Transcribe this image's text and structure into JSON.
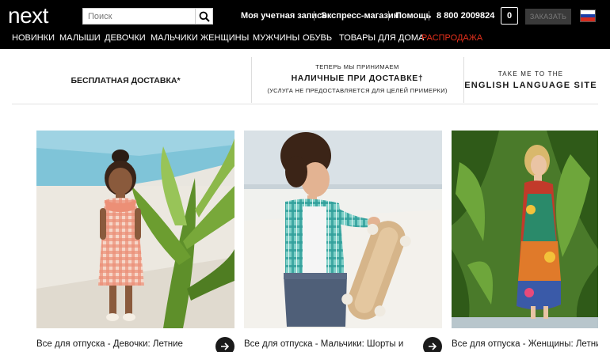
{
  "brand": {
    "logo_text": "next"
  },
  "search": {
    "placeholder": "Поиск"
  },
  "utility": {
    "account": "Моя учетная запись",
    "express": "Экспресс-магазин",
    "help": "Помощь",
    "phone": "8 800 2009824"
  },
  "bag": {
    "count": "0"
  },
  "order_button": "ЗАКАЗАТЬ",
  "nav": [
    "НОВИНКИ",
    "МАЛЫШИ",
    "ДЕВОЧКИ",
    "МАЛЬЧИКИ",
    "ЖЕНЩИНЫ",
    "МУЖЧИНЫ",
    "ОБУВЬ",
    "ТОВАРЫ ДЛЯ ДОМА",
    "РАСПРОДАЖА"
  ],
  "promo": {
    "free_delivery": "БЕСПЛАТНАЯ ДОСТАВКА*",
    "cash_line1": "ТЕПЕРЬ МЫ ПРИНИМАЕМ",
    "cash_line2": "НАЛИЧНЫЕ ПРИ ДОСТАВКЕ†",
    "cash_line3": "(УСЛУГА НЕ ПРЕДОСТАВЛЯЕТСЯ ДЛЯ ЦЕЛЕЙ ПРИМЕРКИ)",
    "english_line1": "TAKE ME TO THE",
    "english_line2": "ENGLISH LANGUAGE SITE"
  },
  "tiles": [
    {
      "caption": "Все для отпуска - Девочки: Летние"
    },
    {
      "caption": "Все для отпуска - Мальчики: Шорты и"
    },
    {
      "caption": "Все для отпуска - Женщины: Летние"
    }
  ],
  "colors": {
    "header_bg": "#000000",
    "sale": "#e4301c",
    "text": "#1a1a1a"
  }
}
